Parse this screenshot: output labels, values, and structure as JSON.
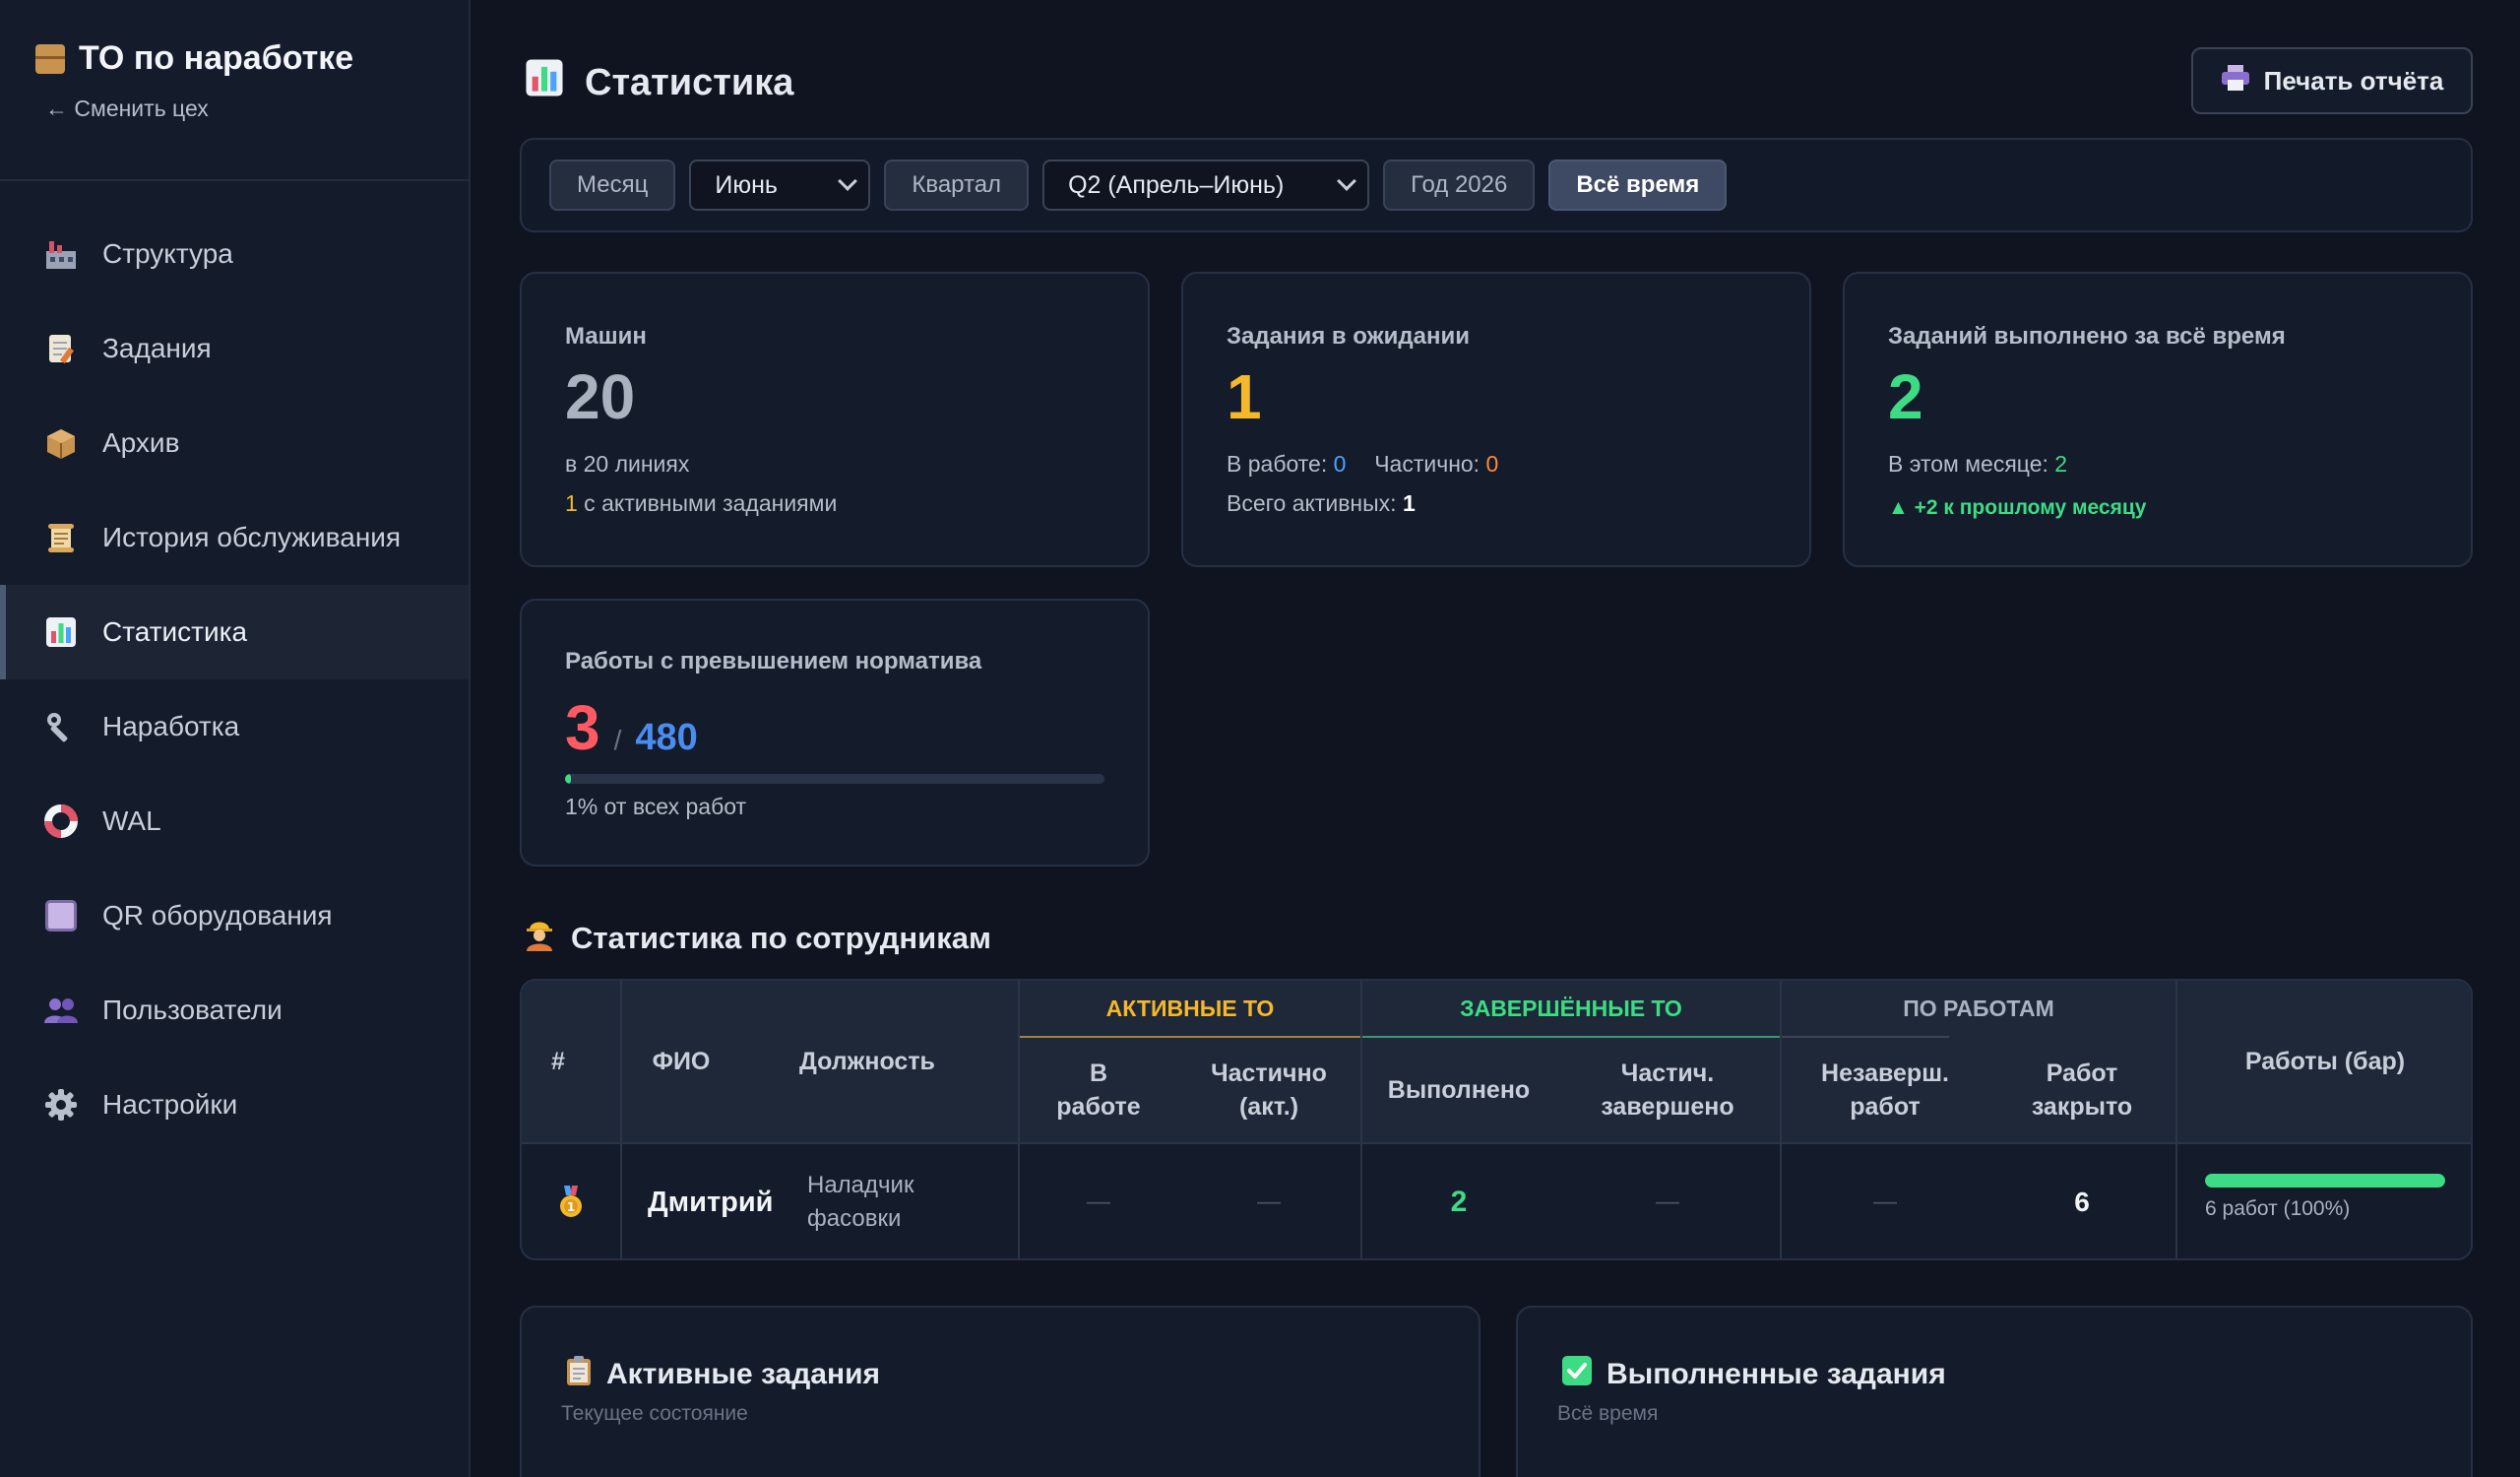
{
  "app": {
    "title": "ТО по наработке",
    "back_link": "← Сменить цех"
  },
  "sidebar": {
    "items": [
      {
        "label": "Структура",
        "icon": "factory-icon"
      },
      {
        "label": "Задания",
        "icon": "memo-icon"
      },
      {
        "label": "Архив",
        "icon": "package-icon"
      },
      {
        "label": "История обслуживания",
        "icon": "scroll-icon"
      },
      {
        "label": "Статистика",
        "icon": "bar-chart-icon",
        "active": true
      },
      {
        "label": "Наработка",
        "icon": "wrench-icon"
      },
      {
        "label": "WAL",
        "icon": "lifebuoy-icon"
      },
      {
        "label": "QR оборудования",
        "icon": "qr-square-icon"
      },
      {
        "label": "Пользователи",
        "icon": "users-icon"
      },
      {
        "label": "Настройки",
        "icon": "gear-icon"
      }
    ]
  },
  "header": {
    "title": "Статистика",
    "print_label": "Печать отчёта"
  },
  "filters": {
    "month_label": "Месяц",
    "month_value": "Июнь",
    "quarter_label": "Квартал",
    "quarter_value": "Q2 (Апрель–Июнь)",
    "year_label": "Год 2026",
    "all_time_label": "Всё время"
  },
  "cards": {
    "machines": {
      "label": "Машин",
      "value": "20",
      "sub": "в 20 линиях",
      "active_count": "1",
      "active_text": " с активными заданиями"
    },
    "pending": {
      "label": "Задания в ожидании",
      "value": "1",
      "in_work_label": "В работе: ",
      "in_work_value": "0",
      "partial_label": "Частично: ",
      "partial_value": "0",
      "total_label": "Всего активных: ",
      "total_value": "1"
    },
    "done": {
      "label": "Заданий выполнено за всё время",
      "value": "2",
      "month_label": "В этом месяце: ",
      "month_value": "2",
      "delta": "▲ +2 к прошлому месяцу"
    },
    "overrun": {
      "label": "Работы с превышением норматива",
      "value": "3",
      "separator": "/",
      "total": "480",
      "progress": 0.01,
      "footer": "1% от всех работ"
    }
  },
  "staff": {
    "title": "Статистика по сотрудникам",
    "groups": {
      "active": "АКТИВНЫЕ ТО",
      "completed": "ЗАВЕРШЁННЫЕ ТО",
      "by_work": "ПО РАБОТАМ"
    },
    "columns": {
      "num": "#",
      "name": "ФИО",
      "position": "Должность",
      "in_work_1": "В",
      "in_work_2": "работе",
      "partial_1": "Частично",
      "partial_2": "(акт.)",
      "done": "Выполнено",
      "partial_done_1": "Частич.",
      "partial_done_2": "завершено",
      "unfinished_1": "Незаверш.",
      "unfinished_2": "работ",
      "closed_1": "Работ",
      "closed_2": "закрыто",
      "bar": "Работы (бар)"
    },
    "rows": [
      {
        "name": "Дмитрий",
        "position_1": "Наладчик",
        "position_2": "фасовки",
        "in_work": "—",
        "partial": "—",
        "done": "2",
        "partial_done": "—",
        "unfinished": "—",
        "closed": "6",
        "bar_fraction": 1.0,
        "bar_label": "6 работ (100%)"
      }
    ]
  },
  "panels": {
    "active": {
      "title": "Активные задания",
      "sub": "Текущее состояние"
    },
    "completed": {
      "title": "Выполненные задания",
      "sub": "Всё время"
    }
  },
  "colors": {
    "yellow": "#f5b82a",
    "green": "#3ddc84",
    "blue": "#4aa3ff",
    "orange": "#ff8a3d",
    "red": "#ff5a64",
    "gray_value": "#aab2c0"
  }
}
